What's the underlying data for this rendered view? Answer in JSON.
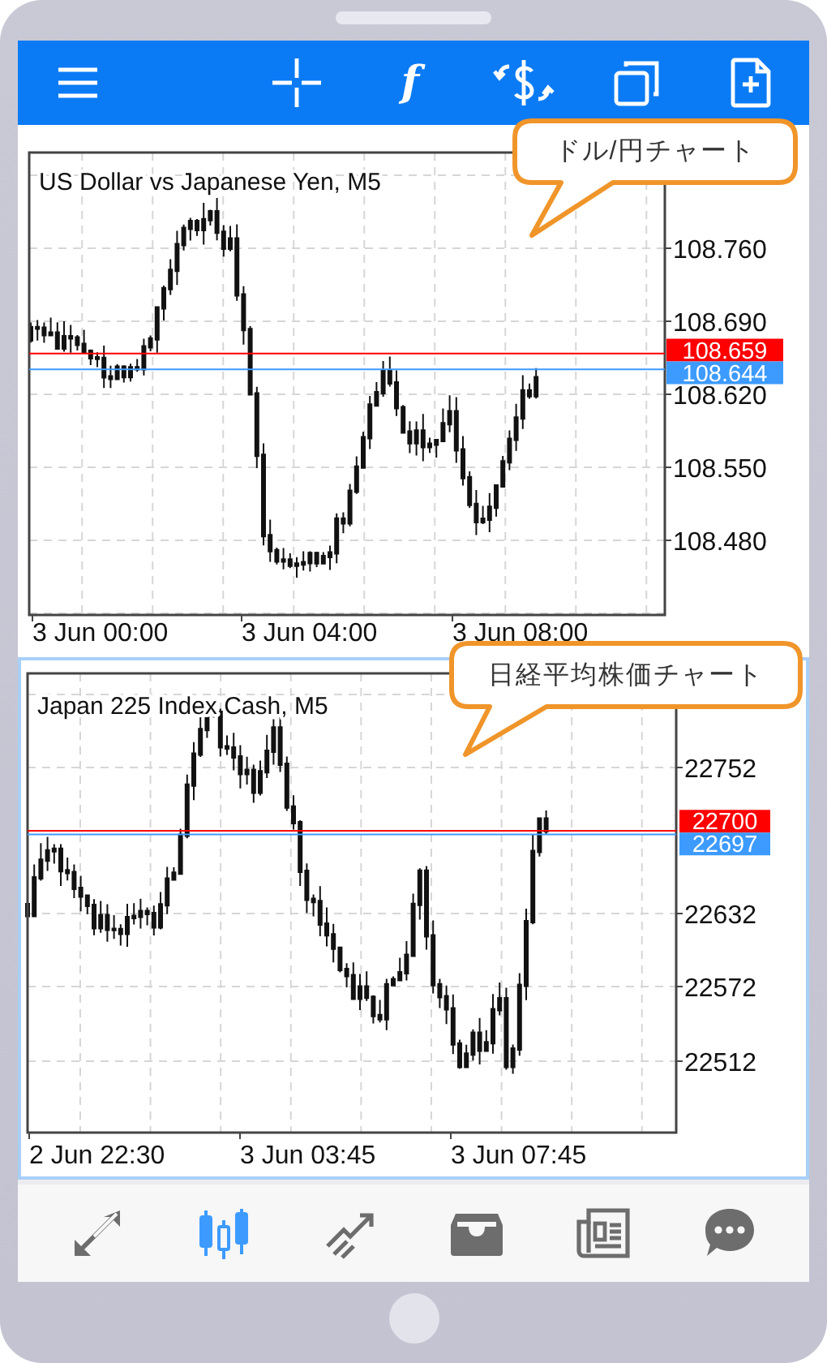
{
  "toolbar": {
    "items": [
      {
        "kind": "menu"
      },
      {
        "kind": "crosshair"
      },
      {
        "kind": "indicators",
        "text": "f"
      },
      {
        "kind": "trade"
      },
      {
        "kind": "windows"
      },
      {
        "kind": "new_order"
      }
    ]
  },
  "charts": [
    {
      "title": "US Dollar vs Japanese Yen, M5",
      "selected": false,
      "price_ticks": [
        "108.760",
        "108.690",
        "108.620",
        "108.550",
        "108.480"
      ],
      "time_labels": [
        "3 Jun 00:00",
        "3 Jun 04:00",
        "3 Jun 08:00"
      ],
      "price_lines": [
        {
          "value": "108.659",
          "color": "#ff0000"
        },
        {
          "value": "108.644",
          "color": "#3d9bff"
        }
      ],
      "callout": "ドル/円チャート"
    },
    {
      "title": "Japan 225 Index Cash, M5",
      "selected": true,
      "price_ticks": [
        "22752",
        "22632",
        "22572",
        "22512"
      ],
      "time_labels": [
        "2 Jun 22:30",
        "3 Jun 03:45",
        "3 Jun 07:45"
      ],
      "price_lines": [
        {
          "value": "22700",
          "color": "#ff0000"
        },
        {
          "value": "22697",
          "color": "#3d9bff"
        }
      ],
      "callout": "日経平均株価チャート"
    }
  ],
  "bottom_nav": [
    {
      "kind": "quotes",
      "selected": false
    },
    {
      "kind": "chart",
      "selected": true
    },
    {
      "kind": "trade",
      "selected": false
    },
    {
      "kind": "history",
      "selected": false
    },
    {
      "kind": "news",
      "selected": false
    },
    {
      "kind": "chat",
      "selected": false
    }
  ]
}
